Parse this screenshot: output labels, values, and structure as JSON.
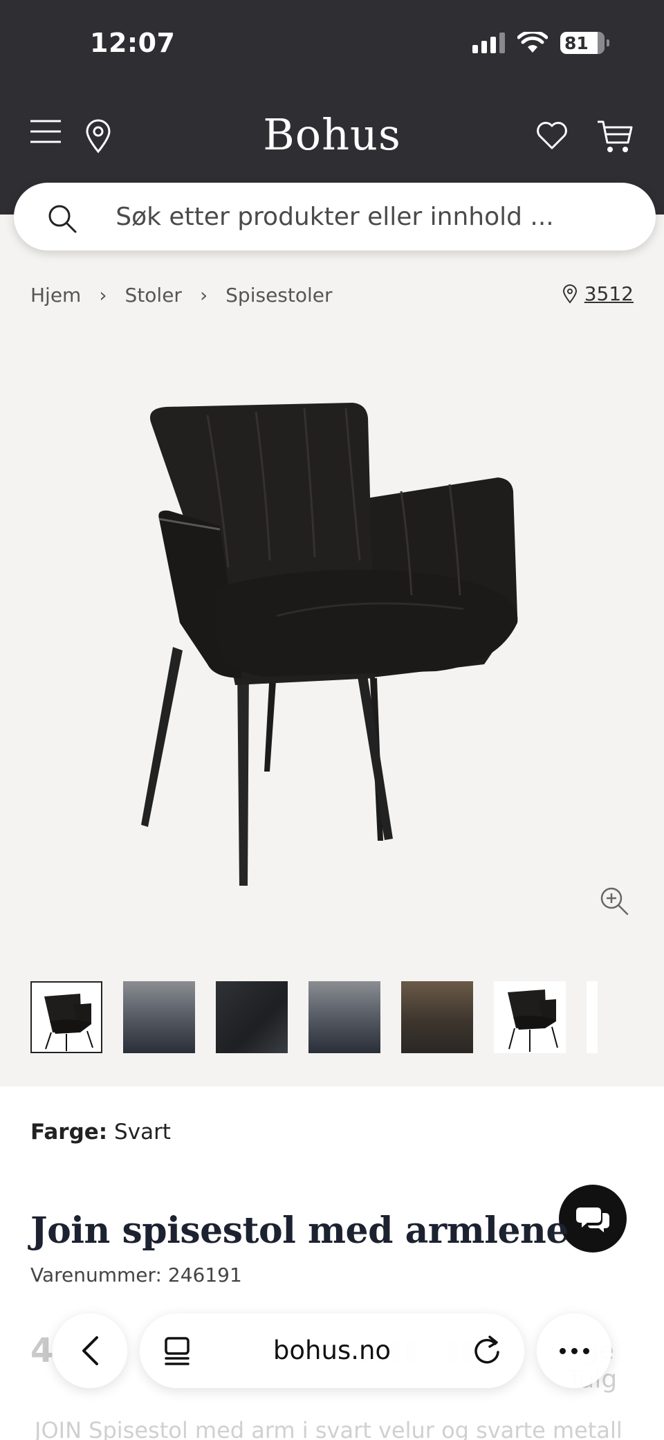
{
  "status_bar": {
    "time": "12:07",
    "battery": "81"
  },
  "header": {
    "logo": "Bohus"
  },
  "search": {
    "placeholder": "Søk etter produkter eller innhold ..."
  },
  "breadcrumb": [
    "Hjem",
    "Stoler",
    "Spisestoler"
  ],
  "store": {
    "number": "3512"
  },
  "thumbnails": [
    "chair-front",
    "dining-scene",
    "fabric-closeup",
    "dining-scene-2",
    "living-room-scene",
    "chair-front-2"
  ],
  "product": {
    "color_label": "Farge:",
    "color_value": "Svart",
    "title": "Join spisestol med armlene",
    "sku_label": "Varenummer:",
    "sku": "246191",
    "price_partial": "4",
    "right_partial": "nge Tulg",
    "description_partial": "JOIN Spisestol med arm i svart velur og svarte metall"
  },
  "browser": {
    "domain": "bohus.no"
  },
  "colors": {
    "header_bg": "#2e2e33",
    "product_bg": "#f4f3f1",
    "title": "#1c2230"
  }
}
